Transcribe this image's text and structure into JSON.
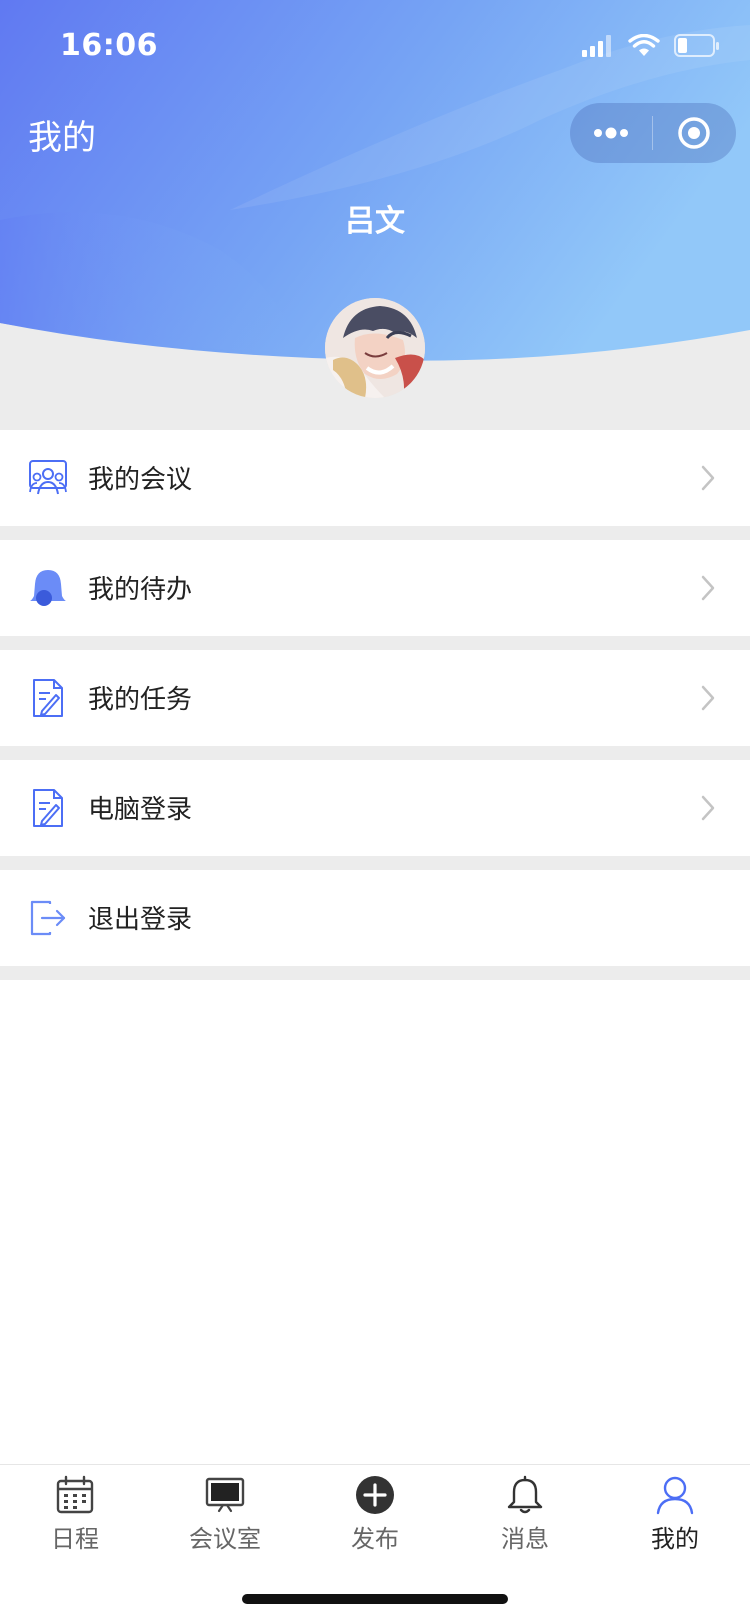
{
  "status_bar": {
    "time": "16:06",
    "icons": [
      "signal-icon",
      "wifi-icon",
      "battery-icon"
    ]
  },
  "header": {
    "title": "我的",
    "capsule": {
      "more_icon": "more-dots-icon",
      "close_icon": "target-close-icon"
    },
    "user_name": "吕文",
    "avatar_icon": "avatar-image"
  },
  "menu": {
    "items": [
      {
        "label": "我的会议",
        "icon": "meeting-people-icon",
        "has_arrow": true
      },
      {
        "label": "我的待办",
        "icon": "bell-icon",
        "has_arrow": true
      },
      {
        "label": "我的任务",
        "icon": "task-document-icon",
        "has_arrow": true
      },
      {
        "label": "电脑登录",
        "icon": "pc-login-document-icon",
        "has_arrow": true
      },
      {
        "label": "退出登录",
        "icon": "logout-icon",
        "has_arrow": false
      }
    ]
  },
  "tabbar": {
    "items": [
      {
        "label": "日程",
        "icon": "calendar-icon"
      },
      {
        "label": "会议室",
        "icon": "meeting-room-screen-icon"
      },
      {
        "label": "发布",
        "icon": "plus-circle-icon"
      },
      {
        "label": "消息",
        "icon": "bell-outline-icon"
      },
      {
        "label": "我的",
        "icon": "user-icon"
      }
    ],
    "active_index": 4
  },
  "colors": {
    "accent": "#4c6ef5",
    "header_gradient_start": "#5f7ef2",
    "header_gradient_end": "#8fc4f8",
    "divider": "#ececec",
    "chevron": "#c4c4c4"
  }
}
